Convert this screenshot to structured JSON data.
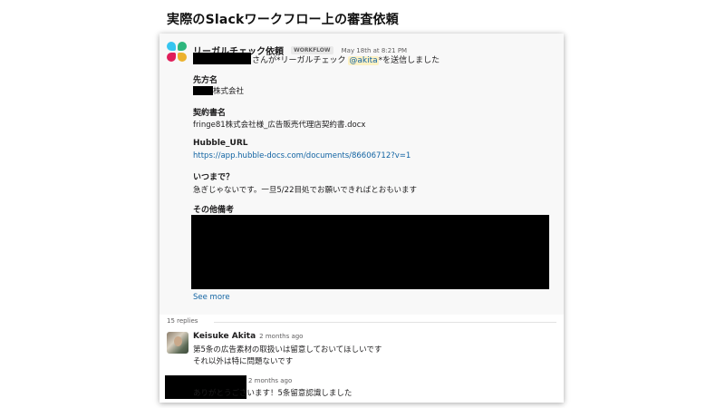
{
  "slide_title": "実際のSlackワークフロー上の審査依頼",
  "message": {
    "sender": "リーガルチェック依頼",
    "badge": "WORKFLOW",
    "timestamp": "May 18th at 8:21 PM",
    "sent_prefix": "さんが*リーガルチェック ",
    "mention": "@akita",
    "sent_suffix": "*を送信しました",
    "fields": {
      "client_label": "先方名",
      "client_value": "株式会社",
      "contract_label": "契約書名",
      "contract_value": "fringe81株式会社様_広告販売代理店契約書.docx",
      "hubble_label": "Hubble_URL",
      "hubble_value": "https://app.hubble-docs.com/documents/86606712?v=1",
      "deadline_label": "いつまで？",
      "deadline_value": "急ぎじゃないです。一旦5/22目処でお願いできればとおもいます",
      "other_label": "その他備考"
    },
    "see_more": "See more"
  },
  "thread": {
    "count": "15 replies",
    "replies": [
      {
        "author": "Keisuke Akita",
        "time": "2 months ago",
        "line1": "第5条の広告素材の取扱いは留意しておいてほしいです",
        "line2": "それ以外は特に問題ないです"
      },
      {
        "author": "",
        "time": "2 months ago",
        "line1": "ありがとうございます！5条留意認識しました"
      }
    ]
  },
  "colors": {
    "link": "#1264a3",
    "mention_bg": "#fdf1c4",
    "redaction": "#000000",
    "logo": [
      "#36c5f0",
      "#2eb67d",
      "#e01e5a",
      "#ecb22e"
    ]
  }
}
